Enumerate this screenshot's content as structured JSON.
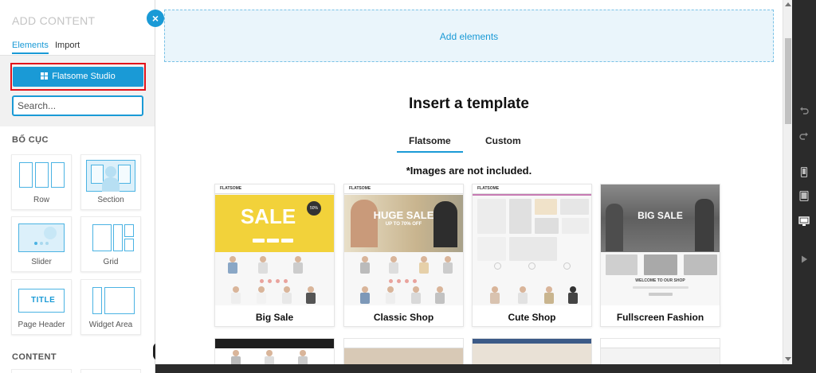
{
  "sidebar": {
    "title": "ADD CONTENT",
    "close_glyph": "×",
    "tabs": [
      {
        "label": "Elements",
        "active": true
      },
      {
        "label": "Import",
        "active": false
      }
    ],
    "studio_button": {
      "label": "Flatsome Studio",
      "icon": "grid-icon"
    },
    "search": {
      "placeholder": "Search...",
      "value": ""
    },
    "sections": [
      {
        "label": "BỐ CỤC",
        "items": [
          "Row",
          "Section",
          "Slider",
          "Grid",
          "Page Header",
          "Widget Area"
        ]
      },
      {
        "label": "CONTENT"
      }
    ],
    "title_art": "TITLE"
  },
  "canvas": {
    "add_elements": "Add elements",
    "heading": "Insert a template",
    "tabs": [
      {
        "label": "Flatsome",
        "active": true
      },
      {
        "label": "Custom",
        "active": false
      }
    ],
    "note": "*Images are not included.",
    "templates": [
      {
        "name": "Big Sale",
        "hero_text": "SALE",
        "badge": "50%"
      },
      {
        "name": "Classic Shop",
        "hero_text": "HUGE SALE",
        "hero_sub": "UP TO 70% OFF"
      },
      {
        "name": "Cute Shop"
      },
      {
        "name": "Fullscreen Fashion",
        "hero_text": "BIG SALE",
        "hero_sub": "WELCOME TO OUR SHOP"
      }
    ],
    "logo_text": "FLATSOME"
  },
  "toolbar": {
    "icons": [
      "undo-icon",
      "redo-icon",
      "mobile-icon",
      "tablet-icon",
      "desktop-icon",
      "play-icon"
    ],
    "active": "desktop-icon"
  },
  "colors": {
    "accent": "#1a9ad6",
    "highlight": "#e3131b",
    "dark": "#2b2b2b"
  }
}
